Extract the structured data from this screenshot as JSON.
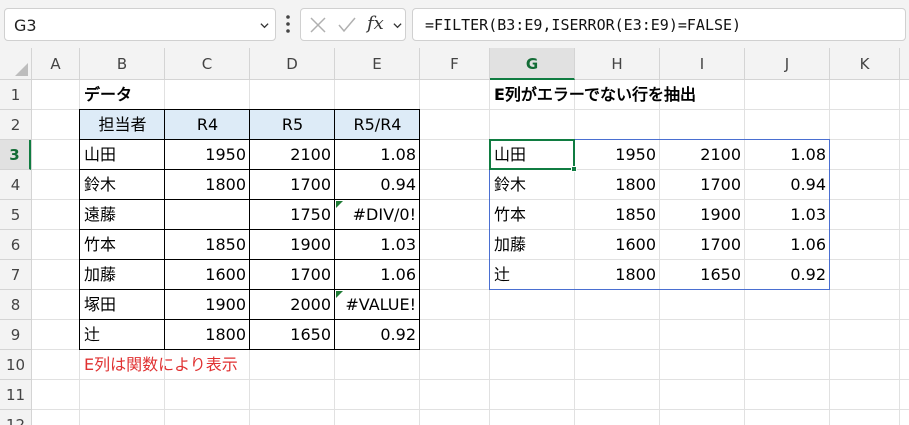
{
  "formula_bar": {
    "name_box": "G3",
    "fx": "fx",
    "formula": "=FILTER(B3:E9,ISERROR(E3:E9)=FALSE)"
  },
  "columns": [
    "A",
    "B",
    "C",
    "D",
    "E",
    "F",
    "G",
    "H",
    "I",
    "J",
    "K"
  ],
  "rows": [
    "1",
    "2",
    "3",
    "4",
    "5",
    "6",
    "7",
    "8",
    "9",
    "10",
    "11",
    "12"
  ],
  "selected": {
    "column": "G",
    "row": "3"
  },
  "sheet": {
    "title1": "データ",
    "title2": "E列がエラーでない行を抽出",
    "note": "E列は関数により表示",
    "headers": [
      "担当者",
      "R4",
      "R5",
      "R5/R4"
    ],
    "source_rows": [
      [
        "山田",
        "1950",
        "2100",
        "1.08"
      ],
      [
        "鈴木",
        "1800",
        "1700",
        "0.94"
      ],
      [
        "遠藤",
        "",
        "1750",
        "#DIV/0!"
      ],
      [
        "竹本",
        "1850",
        "1900",
        "1.03"
      ],
      [
        "加藤",
        "1600",
        "1700",
        "1.06"
      ],
      [
        "塚田",
        "1900",
        "2000",
        "#VALUE!"
      ],
      [
        "辻",
        "1800",
        "1650",
        "0.92"
      ]
    ],
    "result_rows": [
      [
        "山田",
        "1950",
        "2100",
        "1.08"
      ],
      [
        "鈴木",
        "1800",
        "1700",
        "0.94"
      ],
      [
        "竹本",
        "1850",
        "1900",
        "1.03"
      ],
      [
        "加藤",
        "1600",
        "1700",
        "1.06"
      ],
      [
        "辻",
        "1800",
        "1650",
        "0.92"
      ]
    ]
  },
  "colors": {
    "header_fill": "#ddebf7",
    "note_text": "#e03131",
    "selection": "#107c41",
    "spill_border": "#4a6fd1"
  }
}
